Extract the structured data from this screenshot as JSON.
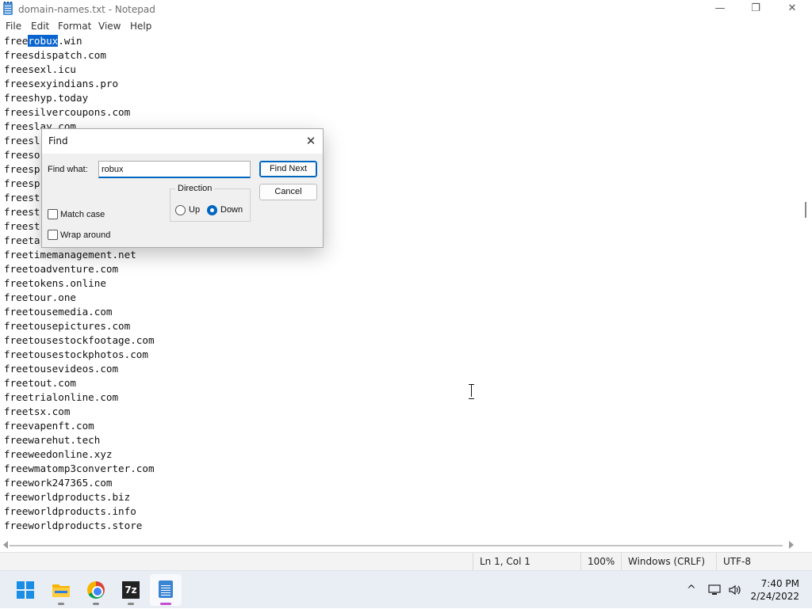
{
  "window": {
    "title": "domain-names.txt - Notepad",
    "icon": "notepad-icon",
    "minimize": "—",
    "maximize": "❐",
    "close": "✕"
  },
  "menu": [
    "File",
    "Edit",
    "Format",
    "View",
    "Help"
  ],
  "editor": {
    "first_line": {
      "prefix": "free",
      "selected": "robux",
      "suffix": ".win"
    },
    "lines": [
      "freesdispatch.com",
      "freesexl.icu",
      "freesexyindians.pro",
      "freeshyp.today",
      "freesilvercoupons.com",
      "freeslay.com",
      "freesl",
      "freeso",
      "freesp",
      "freesp",
      "freest",
      "freest",
      "freest",
      "freeta",
      "freetimemanagement.net",
      "freetoadventure.com",
      "freetokens.online",
      "freetour.one",
      "freetousemedia.com",
      "freetousepictures.com",
      "freetousestockfootage.com",
      "freetousestockphotos.com",
      "freetousevideos.com",
      "freetout.com",
      "freetrialonline.com",
      "freetsx.com",
      "freevapenft.com",
      "freewarehut.tech",
      "freeweedonline.xyz",
      "freewmatomp3converter.com",
      "freework247365.com",
      "freeworldproducts.biz",
      "freeworldproducts.info",
      "freeworldproducts.store"
    ]
  },
  "find_dialog": {
    "title": "Find",
    "find_what_label": "Find what:",
    "find_what_value": "robux",
    "find_next_label": "Find Next",
    "cancel_label": "Cancel",
    "direction_label": "Direction",
    "up_label": "Up",
    "down_label": "Down",
    "direction_selected": "Down",
    "match_case_label": "Match case",
    "wrap_around_label": "Wrap around",
    "close_glyph": "✕"
  },
  "statusbar": {
    "position": "Ln 1, Col 1",
    "zoom": "100%",
    "line_ending": "Windows (CRLF)",
    "encoding": "UTF-8"
  },
  "taskbar": {
    "apps": [
      "start-icon",
      "file-explorer-icon",
      "chrome-icon",
      "7zip-icon",
      "notepad-icon"
    ],
    "sevenzip_text": "7z",
    "clock_time": "7:40 PM",
    "clock_date": "2/24/2022",
    "tray_chevron": "^"
  },
  "colors": {
    "selection": "#0a64cf",
    "accent": "#0067c0",
    "taskbar_bg": "#e9eef5"
  }
}
